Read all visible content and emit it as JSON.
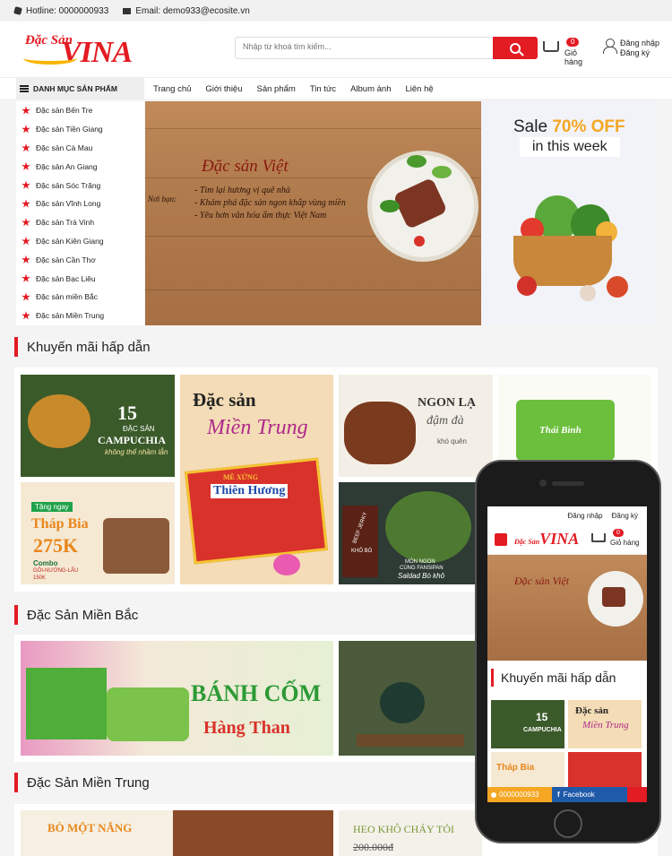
{
  "topbar": {
    "hotline": "Hotline: 0000000933",
    "email": "Email: demo933@ecosite.vn"
  },
  "header": {
    "logo_small": "Đặc Sản",
    "logo_big": "VINA",
    "search_placeholder": "Nhập từ khoá tìm kiếm...",
    "cart_count": "0",
    "cart_label": "Giỏ hàng",
    "login": "Đăng nhập",
    "register": "Đăng ký"
  },
  "nav": {
    "category_title": "DANH MỤC SẢN PHẨM",
    "items": [
      "Trang chủ",
      "Giới thiệu",
      "Sản phẩm",
      "Tin tức",
      "Album ảnh",
      "Liên hệ"
    ]
  },
  "sidebar": {
    "items": [
      "Đặc sản Bến Tre",
      "Đặc sản Tiền Giang",
      "Đặc sản Cà Mau",
      "Đặc sản An Giang",
      "Đặc sản Sóc Trăng",
      "Đặc sản Vĩnh Long",
      "Đặc sản Trà Vinh",
      "Đặc sản Kiên Giang",
      "Đặc sản Cần Thơ",
      "Đặc sản Bạc Liêu",
      "Đặc sản miền Bắc",
      "Đặc sản Miền Trung"
    ]
  },
  "hero": {
    "title": "Đặc sản Việt",
    "noi_ban": "Nơi bạn:",
    "lines": [
      "- Tìm lại hương vị quê nhà",
      "- Khám phá đặc sản ngon khắp vùng miền",
      "- Yêu hơn văn hóa ẩm thực Việt Nam"
    ]
  },
  "sale": {
    "prefix": "Sale ",
    "highlight": "70% OFF",
    "sub": "in this week"
  },
  "sections": {
    "promo": "Khuyến mãi hấp dẫn",
    "north": "Đặc Sản Miền Bắc",
    "central": "Đặc Sản Miền Trung"
  },
  "promo_tiles": {
    "campuchia_num": "15",
    "campuchia_label": "ĐẶC SẢN",
    "campuchia_name": "CAMPUCHIA",
    "campuchia_sub": "không thể nhầm lẫn",
    "thap_bia_tag": "Tặng ngay",
    "thap_bia": "Tháp Bia",
    "thap_bia_price": "275K",
    "combo": "Combo",
    "combo_items": "GỎI-NƯỚNG-LẨU",
    "combo_price": "150K",
    "mt_dac_san": "Đặc sản",
    "mt_name": "Miền Trung",
    "me_xung": "MÈ XỬNG",
    "thien_huong": "Thiên Hương",
    "ngon_la": "NGON LẠ",
    "dam_da": "đậm đà",
    "kho_quen": "khó quên",
    "thai_binh": "Thái Bình",
    "beef_jerky": "BEEF JERKY",
    "kho_bo": "KHÔ BÒ",
    "mon_ngon": "MÓN NGON",
    "fansipan": "CÙNG FANSIPAN",
    "salad": "Saldad Bò khô"
  },
  "north_tiles": {
    "banh_com": "BÁNH CỐM",
    "hang_than": "Hàng Than"
  },
  "central_tiles": {
    "bo_mot_nang": "BÒ MỘT NẮNG",
    "heo_kho": "HEO KHÔ CHÁY TỎI",
    "heo_price": "200.000đ"
  },
  "phone": {
    "login": "Đăng nhập",
    "register": "Đăng ký",
    "logo_small": "Đặc Sản",
    "logo_big": "VINA",
    "cart_count": "0",
    "cart_label": "Giỏ hàng",
    "banner_title": "Đặc sản Việt",
    "section": "Khuyến mãi hấp dẫn",
    "tile_num": "15",
    "tile_name": "CAMPUCHIA",
    "tile_mt1": "Đặc sản",
    "tile_mt2": "Miền Trung",
    "tile_thap": "Tháp Bia",
    "phone_number": "0000000933",
    "facebook": "Facebook"
  },
  "colors": {
    "brand_red": "#e31b23",
    "sale_yellow": "#f5a623",
    "wood": "#b07b4d"
  }
}
